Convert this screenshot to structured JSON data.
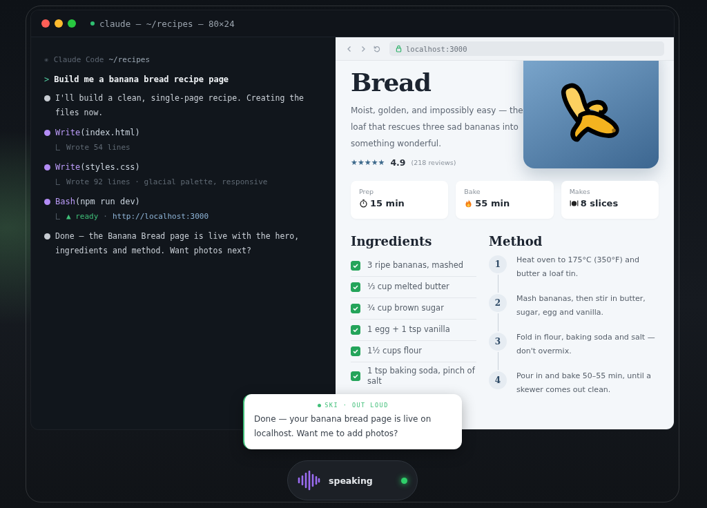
{
  "window": {
    "title": "claude — ~/recipes — 80×24"
  },
  "terminal": {
    "header": {
      "mark": "✳",
      "label": "Claude Code",
      "path": "~/recipes"
    },
    "lines": [
      {
        "kind": "prompt",
        "marker": ">",
        "text": "Build me a banana bread recipe page"
      },
      {
        "kind": "message",
        "text": "I'll build a clean, single-page recipe. Creating the files now."
      },
      {
        "kind": "tool",
        "tool": "Write",
        "arg": "(index.html)",
        "result": {
          "kind": "summary",
          "text": "Wrote 54 lines"
        }
      },
      {
        "kind": "tool",
        "tool": "Write",
        "arg": "(styles.css)",
        "result": {
          "kind": "summary",
          "text": "Wrote 92 lines · glacial palette, responsive"
        }
      },
      {
        "kind": "tool",
        "tool": "Bash",
        "arg": "(npm run dev)",
        "result": {
          "kind": "server",
          "status": "▲ ready",
          "separator": "·",
          "url": "http://localhost:3000"
        }
      },
      {
        "kind": "message",
        "text": "Done — the Banana Bread page is live with the hero, ingredients and method. Want photos next?"
      }
    ]
  },
  "browser": {
    "url": "localhost:3000",
    "recipe": {
      "title": "Bread",
      "description": "Moist, golden, and impossibly easy — the loaf that rescues three sad bananas into something wonderful.",
      "stars": 5,
      "rating": "4.9",
      "reviews": "(218 reviews)",
      "stats": [
        {
          "kind": "timer",
          "label": "Prep",
          "value": "15 min"
        },
        {
          "kind": "flame",
          "label": "Bake",
          "value": "55 min"
        },
        {
          "kind": "plate",
          "label": "Makes",
          "value": "8 slices"
        }
      ],
      "ingredients_title": "Ingredients",
      "ingredients": [
        {
          "text": "3 ripe bananas, mashed",
          "checked": true
        },
        {
          "text": "⅓ cup melted butter",
          "checked": true
        },
        {
          "text": "¾ cup brown sugar",
          "checked": true
        },
        {
          "text": "1 egg + 1 tsp vanilla",
          "checked": true
        },
        {
          "text": "1½ cups flour",
          "checked": true
        },
        {
          "text": "1 tsp baking soda, pinch of salt",
          "checked": true
        }
      ],
      "method_title": "Method",
      "steps": [
        {
          "number": "1",
          "text": "Heat oven to 175°C (350°F) and butter a loaf tin."
        },
        {
          "number": "2",
          "text": "Mash bananas, then stir in butter, sugar, egg and vanilla."
        },
        {
          "number": "3",
          "text": "Fold in flour, baking soda and salt — don't overmix."
        },
        {
          "number": "4",
          "text": "Pour in and bake 50–55 min, until a skewer comes out clean."
        }
      ]
    }
  },
  "voice_bubble": {
    "label": "SKI · OUT LOUD",
    "text": "Done — your banana bread page is live on localhost. Want me to add photos?"
  },
  "voice_pill": {
    "status": "speaking"
  }
}
